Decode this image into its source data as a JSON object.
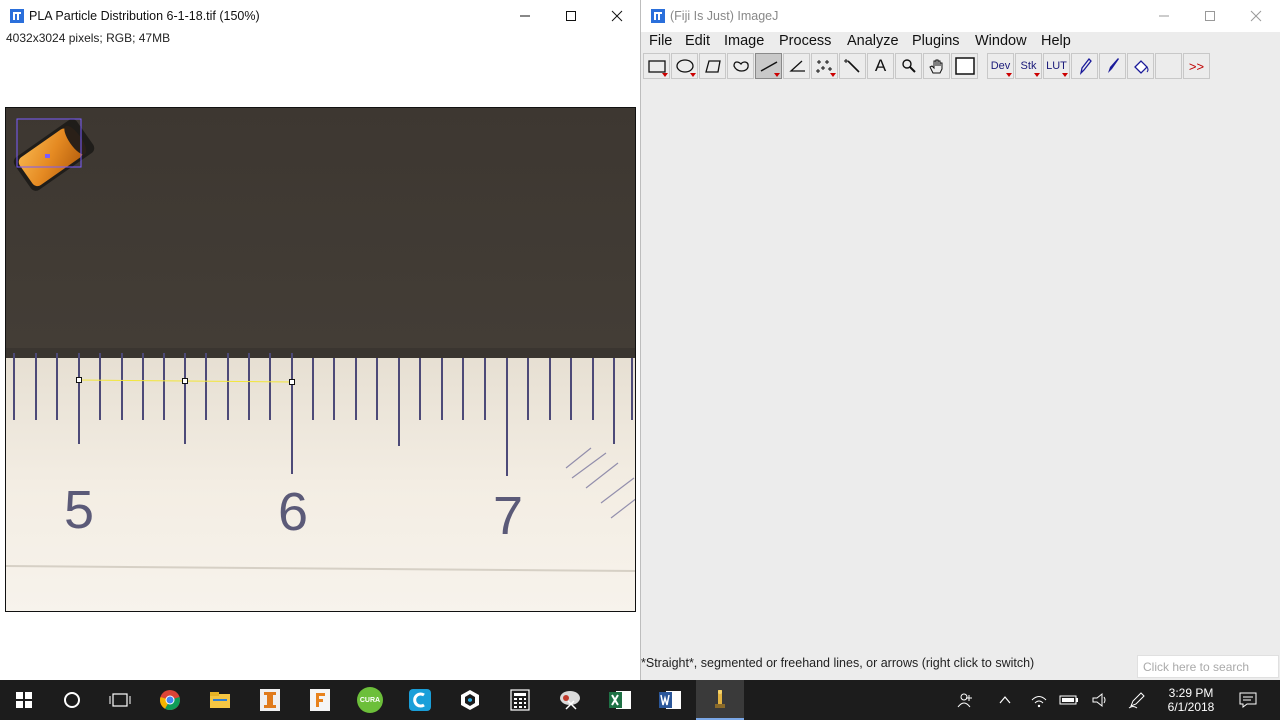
{
  "image_window": {
    "title": "PLA Particle Distribution 6-1-18.tif (150%)",
    "info": "4032x3024 pixels; RGB; 47MB",
    "ruler_labels": [
      "5",
      "6",
      "7"
    ]
  },
  "imagej_window": {
    "title": "(Fiji Is Just) ImageJ",
    "menu": [
      "File",
      "Edit",
      "Image",
      "Process",
      "Analyze",
      "Plugins",
      "Window",
      "Help"
    ],
    "tools": [
      {
        "name": "rectangle-tool-icon",
        "label": ""
      },
      {
        "name": "oval-tool-icon",
        "label": ""
      },
      {
        "name": "polygon-tool-icon",
        "label": ""
      },
      {
        "name": "freehand-tool-icon",
        "label": ""
      },
      {
        "name": "straight-line-tool-icon",
        "label": ""
      },
      {
        "name": "angle-tool-icon",
        "label": ""
      },
      {
        "name": "multipoint-tool-icon",
        "label": ""
      },
      {
        "name": "wand-tool-icon",
        "label": ""
      },
      {
        "name": "text-tool-icon",
        "label": "A"
      },
      {
        "name": "magnifier-tool-icon",
        "label": ""
      },
      {
        "name": "hand-tool-icon",
        "label": ""
      },
      {
        "name": "color-picker-tool-icon",
        "label": ""
      },
      {
        "name": "dev-tool-icon",
        "label": "Dev"
      },
      {
        "name": "stk-tool-icon",
        "label": "Stk"
      },
      {
        "name": "lut-tool-icon",
        "label": "LUT"
      },
      {
        "name": "pencil-tool-icon",
        "label": ""
      },
      {
        "name": "brush-tool-icon",
        "label": ""
      },
      {
        "name": "flood-fill-tool-icon",
        "label": ""
      },
      {
        "name": "blank-tool-slot",
        "label": ""
      },
      {
        "name": "more-tools-icon",
        "label": ">>"
      }
    ],
    "status": "*Straight*, segmented or freehand lines, or arrows (right click to switch)",
    "search_placeholder": "Click here to search"
  },
  "taskbar": {
    "apps": [
      "windows-start-icon",
      "cortana-icon",
      "task-view-icon",
      "chrome-icon",
      "file-explorer-icon",
      "app-i-icon",
      "app-f-icon",
      "cura-icon",
      "app-c-icon",
      "app-3d-icon",
      "calculator-icon",
      "snipping-icon",
      "excel-icon",
      "word-icon",
      "fiji-icon"
    ],
    "cura_label": "CURA",
    "time": "3:29 PM",
    "date": "6/1/2018"
  },
  "colors": {
    "accent_red": "#c00000",
    "selection_purple": "#7a5cff",
    "line_yellow": "#f2e63a",
    "taskbar": "#1c1c1c"
  }
}
